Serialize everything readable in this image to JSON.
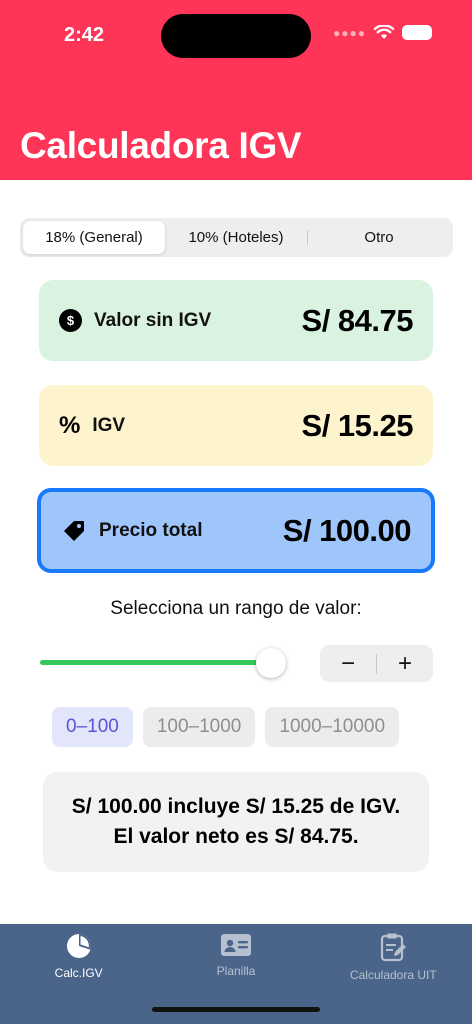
{
  "status": {
    "time": "2:42"
  },
  "header": {
    "title": "Calculadora IGV"
  },
  "tax_rates": {
    "options": [
      "18% (General)",
      "10% (Hoteles)",
      "Otro"
    ],
    "selected_index": 0
  },
  "cards": {
    "net": {
      "label": "Valor sin IGV",
      "amount": "S/ 84.75",
      "icon_glyph": "$",
      "icon": "dollar-circle-icon",
      "color": "#daf3e0"
    },
    "tax": {
      "label": "IGV",
      "amount": "S/ 15.25",
      "icon_glyph": "%",
      "icon": "percent-icon",
      "color": "#fdf4cd"
    },
    "total": {
      "label": "Precio total",
      "amount": "S/ 100.00",
      "icon": "price-tag-icon",
      "color": "#9fc6fb",
      "border_color": "#1779fb"
    }
  },
  "range": {
    "label": "Selecciona un rango de valor:",
    "slider_fraction": 1.0,
    "stepper": {
      "minus": "−",
      "plus": "+"
    },
    "chips": [
      "0–100",
      "100–1000",
      "1000–10000"
    ],
    "selected_chip": 0
  },
  "summary": {
    "line1": "S/ 100.00 incluye S/ 15.25 de IGV.",
    "line2": "El valor neto es S/ 84.75."
  },
  "tabbar": {
    "items": [
      {
        "label": "Calc.IGV",
        "icon": "pie-chart-icon",
        "active": true
      },
      {
        "label": "Planilla",
        "icon": "id-card-icon",
        "active": false
      },
      {
        "label": "Calculadora UIT",
        "icon": "clipboard-icon",
        "active": false
      }
    ]
  },
  "colors": {
    "header": "#fe3557",
    "tabbar": "#4a6589",
    "slider": "#34c759",
    "accent": "#5856d6"
  }
}
